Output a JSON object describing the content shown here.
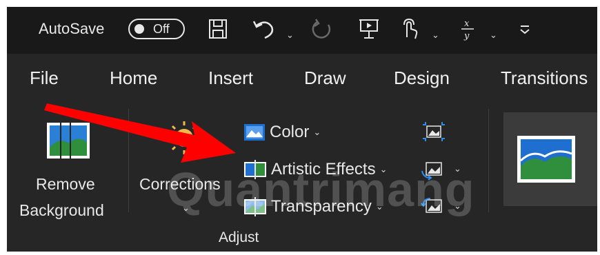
{
  "titlebar": {
    "autosave_label": "AutoSave",
    "autosave_state": "Off"
  },
  "tabs": [
    {
      "label": "File"
    },
    {
      "label": "Home"
    },
    {
      "label": "Insert"
    },
    {
      "label": "Draw"
    },
    {
      "label": "Design"
    },
    {
      "label": "Transitions"
    }
  ],
  "ribbon": {
    "remove_background": {
      "line1": "Remove",
      "line2": "Background"
    },
    "corrections": {
      "label": "Corrections"
    },
    "color": {
      "label": "Color"
    },
    "artistic_effects": {
      "label": "Artistic Effects"
    },
    "transparency": {
      "label": "Transparency"
    },
    "group_label": "Adjust"
  },
  "watermark": "Quantrimang",
  "colors": {
    "accent_blue": "#1f6fd1",
    "accent_green": "#2f8f3c",
    "annotation_red": "#ff0000"
  }
}
